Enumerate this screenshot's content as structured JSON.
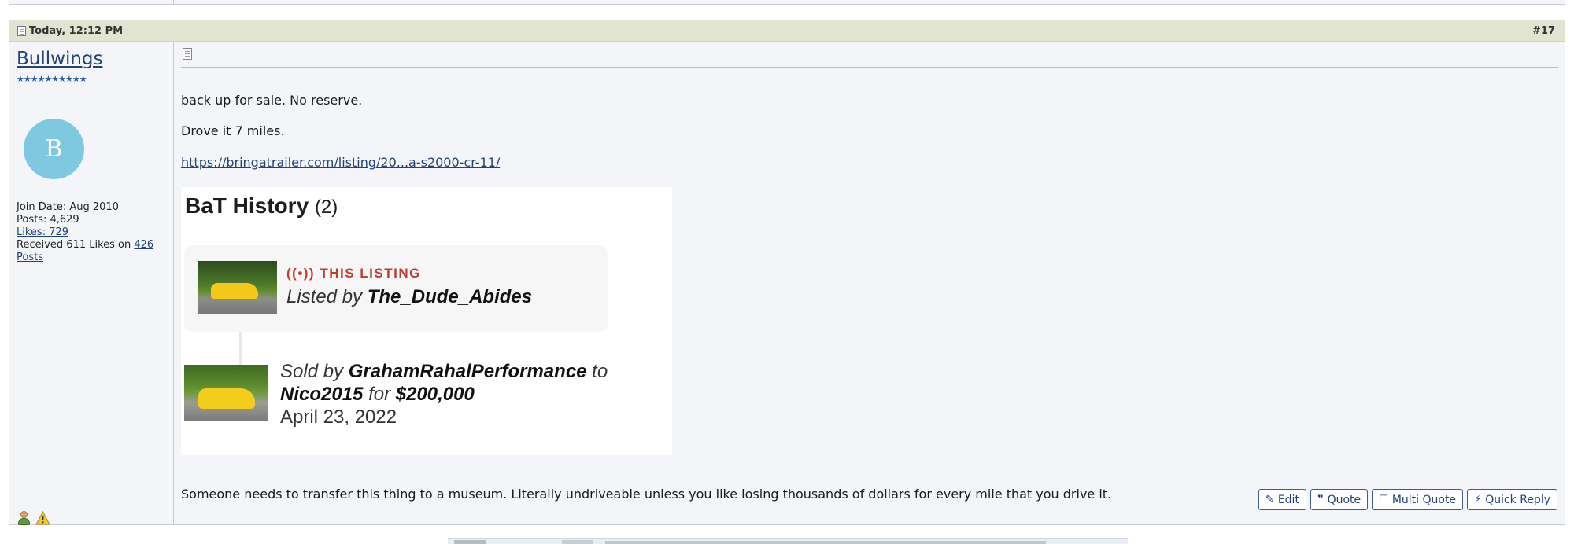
{
  "post": {
    "date": "Today, 12:12 PM",
    "number_prefix": "#",
    "number": "17"
  },
  "user": {
    "name": "Bullwings",
    "stars": "★★★★★★★★★★",
    "avatar_letter": "B",
    "join_date": "Join Date: Aug 2010",
    "posts": "Posts: 4,629",
    "likes": "Likes: 729",
    "received_prefix": "Received 611 Likes on ",
    "received_posts_link": "426 Posts",
    "avatar_color": "#7ec8e0"
  },
  "message": {
    "line1": "back up for sale. No reserve.",
    "line2": "Drove it 7 miles.",
    "link": "https://bringatrailer.com/listing/20...a-s2000-cr-11/",
    "closing": "Someone needs to transfer this thing to a museum. Literally undriveable unless you like losing thousands of dollars for every mile that you drive it."
  },
  "bat": {
    "title": "BaT History",
    "count": "(2)",
    "listing_tag": "THIS LISTING",
    "listed_by_prefix": "Listed by ",
    "listed_by_user": "The_Dude_Abides",
    "sold_prefix": "Sold by ",
    "seller": "GrahamRahalPerformance",
    "sold_to": " to",
    "buyer": "Nico2015",
    "sold_for": " for ",
    "price": "$200,000",
    "sale_date": "April 23, 2022",
    "tag_color": "#c23b32"
  },
  "actions": {
    "edit": "Edit",
    "quote": "Quote",
    "multi_quote": "Multi Quote",
    "quick_reply": "Quick Reply"
  },
  "icons": {
    "post_icon": "document-icon",
    "online_status": "user-online-icon",
    "report": "warning-icon"
  }
}
